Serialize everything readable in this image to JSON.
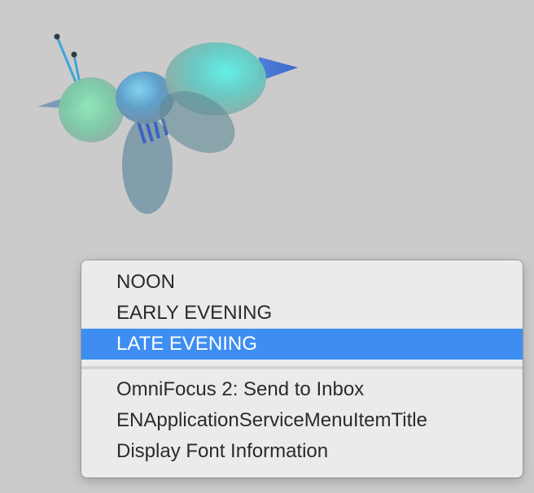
{
  "menu": {
    "group1": [
      {
        "label": "NOON",
        "highlighted": false
      },
      {
        "label": "EARLY EVENING",
        "highlighted": false
      },
      {
        "label": "LATE EVENING",
        "highlighted": true
      }
    ],
    "group2": [
      {
        "label": "OmniFocus 2: Send to Inbox",
        "highlighted": false
      },
      {
        "label": "ENApplicationServiceMenuItemTitle",
        "highlighted": false
      },
      {
        "label": "Display Font Information",
        "highlighted": false
      }
    ],
    "highlight_color": "#3e8ef2"
  },
  "background_color": "#cbcbcb",
  "illustration": {
    "icon": "bee-icon"
  }
}
